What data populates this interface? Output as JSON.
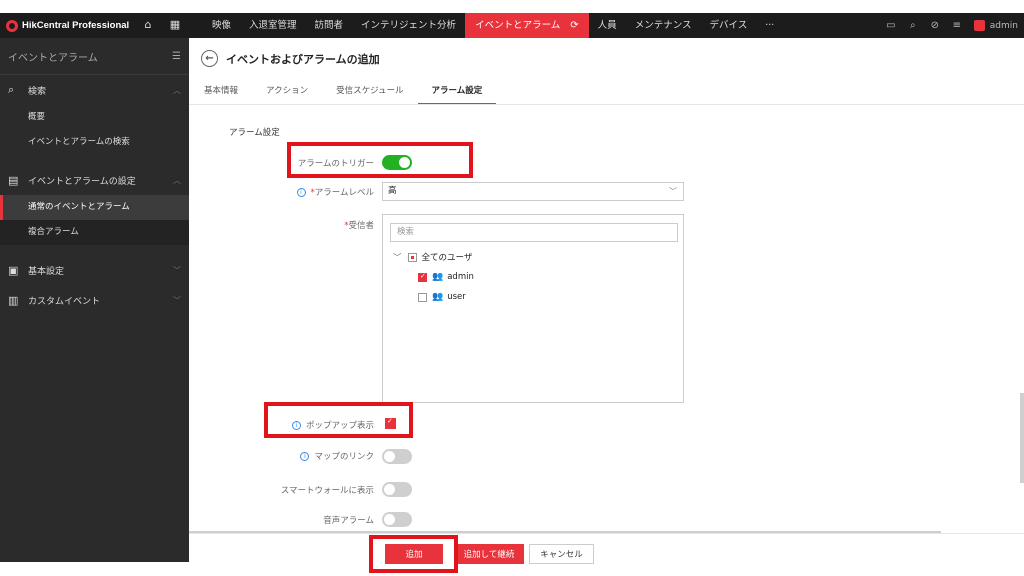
{
  "app": {
    "brand": "HikCentral Professional"
  },
  "nav": {
    "items": [
      "映像",
      "入退室管理",
      "訪問者",
      "インテリジェント分析",
      "イベントとアラーム",
      "人員",
      "メンテナンス",
      "デバイス",
      "···"
    ],
    "active_index": 4,
    "user": "admin"
  },
  "sidebar": {
    "title": "イベントとアラーム",
    "sections": [
      {
        "label": "検索",
        "icon": "search-icon",
        "children": [
          "概要",
          "イベントとアラームの検索"
        ]
      },
      {
        "label": "イベントとアラームの設定",
        "icon": "building-icon",
        "children": [
          "通常のイベントとアラーム",
          "複合アラーム"
        ]
      },
      {
        "label": "基本設定",
        "icon": "settings-panel-icon",
        "children": []
      },
      {
        "label": "カスタムイベント",
        "icon": "document-icon",
        "children": []
      }
    ],
    "active_child": "通常のイベントとアラーム"
  },
  "page": {
    "title": "イベントおよびアラームの追加",
    "tabs": [
      "基本情報",
      "アクション",
      "受信スケジュール",
      "アラーム設定"
    ],
    "active_tab": 3,
    "section": "アラーム設定"
  },
  "form": {
    "trigger_label": "アラームのトリガー",
    "trigger_on": true,
    "level_label": "アラームレベル",
    "level_value": "高",
    "recipients_label": "受信者",
    "search_placeholder": "検索",
    "tree_root": "全てのユーザ",
    "users": [
      {
        "name": "admin",
        "checked": true
      },
      {
        "name": "user",
        "checked": false
      }
    ],
    "popup_label": "ポップアップ表示",
    "popup_checked": true,
    "map_link_label": "マップのリンク",
    "map_link_on": false,
    "smartwall_label": "スマートウォールに表示",
    "smartwall_on": false,
    "audio_label": "音声アラーム",
    "audio_on": false
  },
  "footer": {
    "add": "追加",
    "add_continue": "追加して継続",
    "cancel": "キャンセル"
  },
  "colors": {
    "accent": "#e8323c",
    "toggle_on": "#23b123",
    "highlight": "#e0141b"
  }
}
